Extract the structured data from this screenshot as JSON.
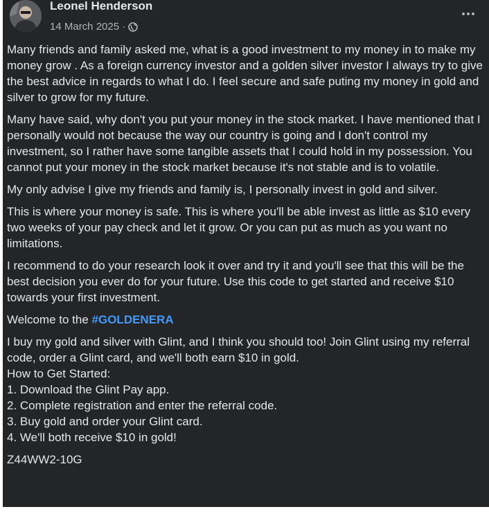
{
  "post": {
    "author": "Leonel Henderson",
    "date": "14 March 2025 · ",
    "privacy_icon": "globe-icon",
    "more_icon": "more-horizontal-icon",
    "paragraphs": [
      "Many friends and family asked me, what is a good investment to my money in to make my money grow . As a foreign currency investor and a golden silver investor I always try to give the best advice in regards to what I do. I feel secure and safe puting my money  in gold and silver to  grow for my future.",
      "Many have said, why don't you put your money in the stock market. I have mentioned that I personally would not because the way our country is going  and I don't control my investment, so I rather have some tangible assets that I could hold in my possession. You cannot put your money in the stock market because it's not stable and is to volatile.",
      "My only  advise I give my friends and family is, I personally invest in gold and silver.",
      "This is where your money is safe. This is where you'll be able invest as little as $10 every two weeks of your pay check and let it grow. Or you can put as much as you want no limitations.",
      "I recommend to do your research look it over and try it and you'll see that this will be the best decision you ever do for your future. Use this code to get started and receive $10 towards your first investment."
    ],
    "welcome_text": "Welcome to the ",
    "hashtag": "#GOLDENERA",
    "glint_intro": "I buy my gold and silver with Glint, and I think you should too! Join Glint using my referral code, order a Glint card, and we'll both earn $10 in gold.",
    "how_to_heading": "How to Get Started:",
    "steps": [
      "1. Download the Glint Pay app.",
      "2. Complete registration and enter the referral code.",
      "3. Buy gold and order your Glint card.",
      "4. We'll both receive $10 in gold!"
    ],
    "referral_code": "Z44WW2-10G"
  },
  "colors": {
    "background": "#242526",
    "text": "#e4e6eb",
    "secondary_text": "#b0b3b8",
    "hashtag": "#4599ff"
  }
}
